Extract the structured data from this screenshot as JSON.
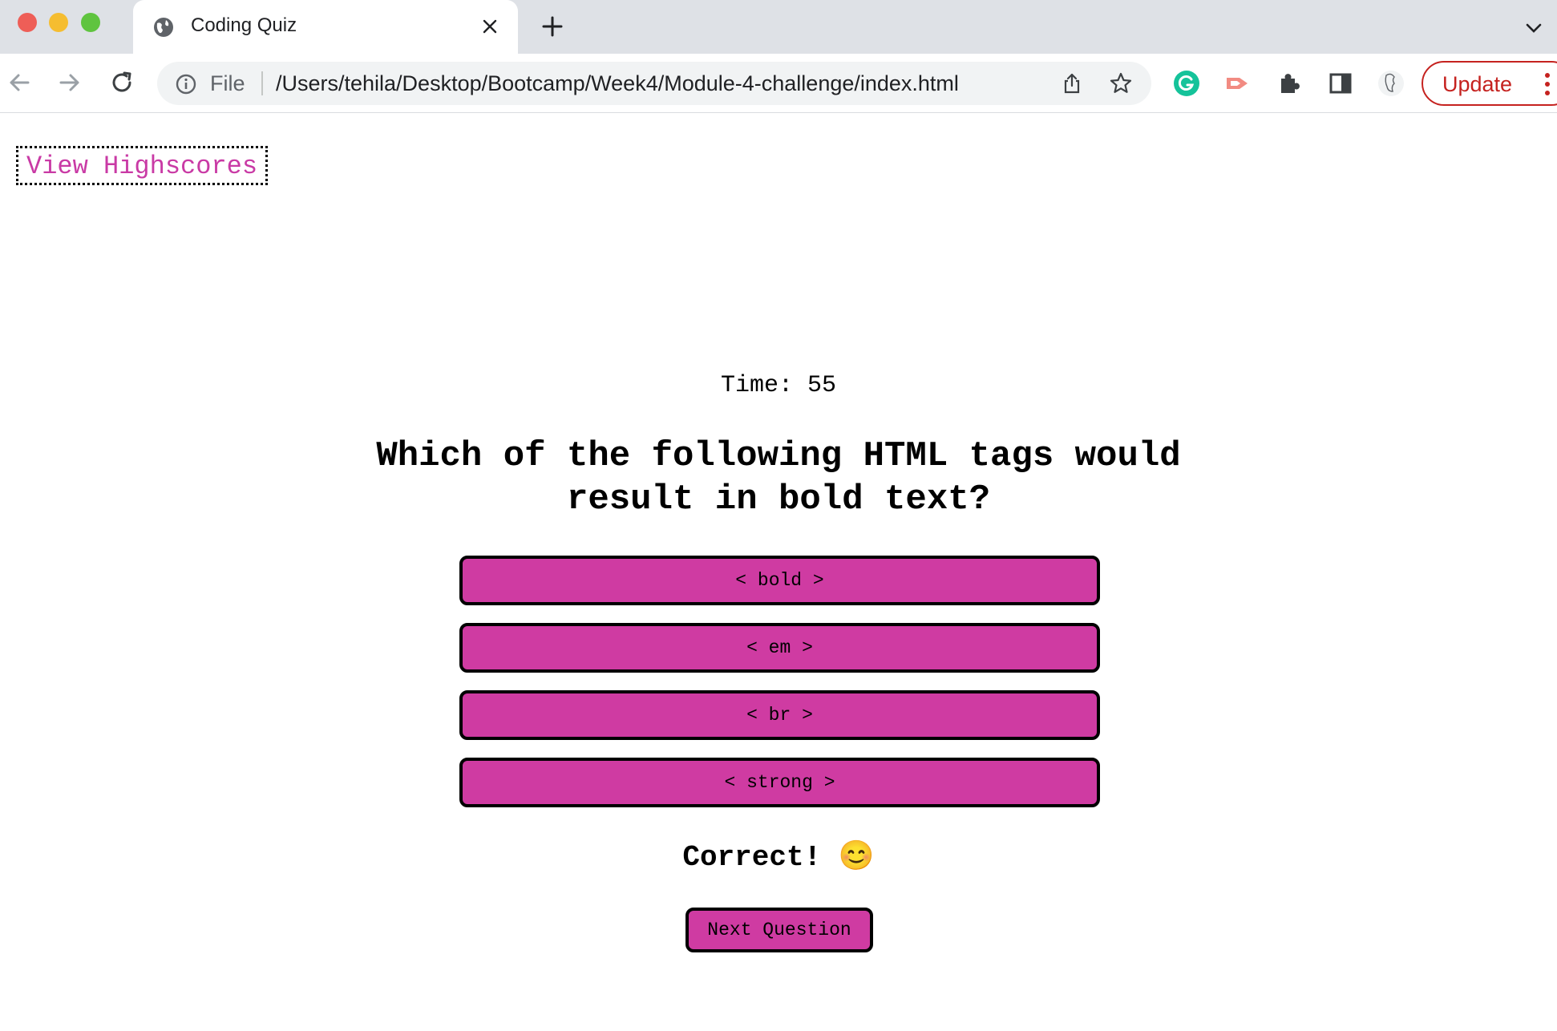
{
  "browser": {
    "tab_title": "Coding Quiz",
    "omnibox": {
      "scheme_label": "File",
      "url": "/Users/tehila/Desktop/Bootcamp/Week4/Module-4-challenge/index.html"
    },
    "update_label": "Update",
    "icons": [
      "back-icon",
      "forward-icon",
      "reload-icon",
      "info-icon",
      "share-icon",
      "star-icon",
      "grammarly-icon",
      "screencast-icon",
      "extensions-icon",
      "side-panel-icon",
      "profile-avatar-icon",
      "more-menu-icon"
    ]
  },
  "page": {
    "highscores_link": "View Highscores",
    "timer": "Time: 55",
    "question": "Which of the following HTML tags would result in bold text?",
    "choices": [
      "< bold >",
      "< em >",
      "< br >",
      "< strong >"
    ],
    "feedback": "Correct! 😊",
    "next_button": "Next Question",
    "colors": {
      "accent": "#cf3ba2",
      "link": "#c93aa5"
    }
  }
}
